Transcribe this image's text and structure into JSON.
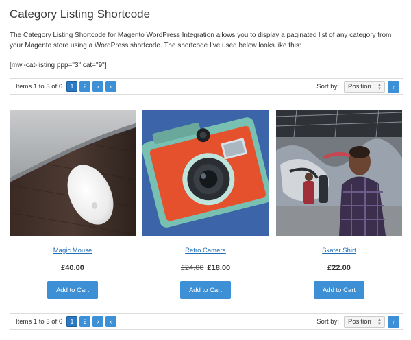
{
  "page": {
    "title": "Category Listing Shortcode",
    "intro": "The Category Listing Shortcode for Magento WordPress Integration allows you to display a paginated list of any category from your Magento store using a WordPress shortcode. The shortcode I've used below looks like this:",
    "shortcode": "[mwi-cat-listing ppp=\"3\" cat=\"9\"]"
  },
  "toolbar": {
    "count": "Items 1 to 3 of 6",
    "pages": [
      "1",
      "2"
    ],
    "next": "›",
    "last": "»",
    "sort_label": "Sort by:",
    "sort_value": "Position",
    "sort_dir": "↑"
  },
  "products": [
    {
      "name": "Magic Mouse",
      "price": "£40.00",
      "old_price": "",
      "button": "Add to Cart"
    },
    {
      "name": "Retro Camera",
      "price": "£18.00",
      "old_price": "£24.00",
      "button": "Add to Cart"
    },
    {
      "name": "Skater Shirt",
      "price": "£22.00",
      "old_price": "",
      "button": "Add to Cart"
    }
  ],
  "colors": {
    "accent": "#3d8fd6",
    "link": "#1f6fb7"
  }
}
